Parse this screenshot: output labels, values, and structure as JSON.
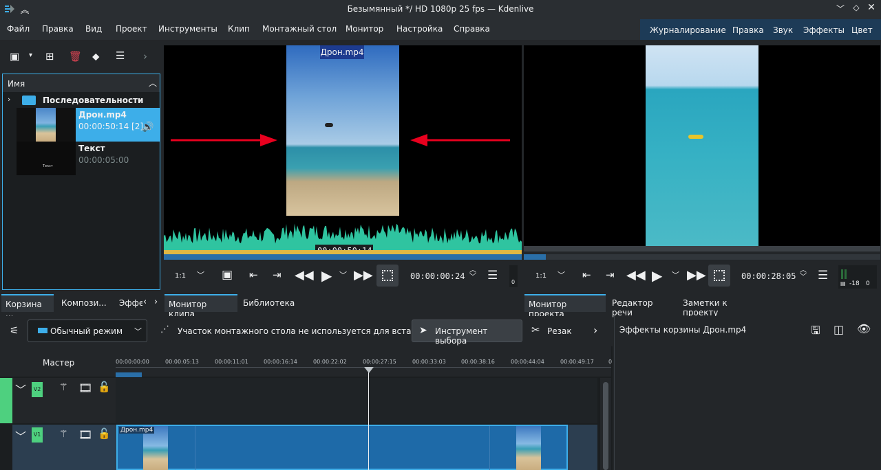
{
  "window": {
    "title": "Безымянный */ HD 1080p 25 fps — Kdenlive"
  },
  "menu": [
    "Файл",
    "Правка",
    "Вид",
    "Проект",
    "Инструменты",
    "Клип",
    "Монтажный стол",
    "Монитор",
    "Настройка",
    "Справка"
  ],
  "workspaces": [
    "Журналирование",
    "Правка",
    "Звук",
    "Эффекты",
    "Цвет"
  ],
  "bin": {
    "column_header": "Имя",
    "folder": "Последовательности",
    "clips": [
      {
        "name": "Дрон.mp4",
        "duration": "00:00:50:14 [2]"
      },
      {
        "name": "Текст",
        "duration": "00:00:05:00",
        "thumb_text": "Текст"
      }
    ]
  },
  "left_tabs": [
    "Корзина ...",
    "Компози...",
    "Эффе"
  ],
  "clip_monitor": {
    "clip_label": "Дрон.mp4",
    "overlay_timecode": "00:00:50:14",
    "zoom": "1:1",
    "timecode": "00:00:00:24",
    "audio_level": "0"
  },
  "clip_monitor_tabs": [
    "Монитор клипа",
    "Библиотека"
  ],
  "project_monitor": {
    "zoom": "1:1",
    "timecode": "00:00:28:05",
    "meter_db": "-18",
    "meter_val": "0"
  },
  "project_monitor_tabs": [
    "Монитор проекта",
    "Редактор речи",
    "Заметки к проекту"
  ],
  "timeline_toolbar": {
    "mode": "Обычный режим",
    "insert_info": "Участок монтажного стола не используется для вставки",
    "select_tool": "Инструмент выбора",
    "razor": "Резак"
  },
  "effects_panel": {
    "title": "Эффекты корзины Дрон.mp4"
  },
  "timeline": {
    "master": "Мастер",
    "ruler": [
      "00:00:00:00",
      "00:00:05:13",
      "00:00:11:01",
      "00:00:16:14",
      "00:00:22:02",
      "00:00:27:15",
      "00:00:33:03",
      "00:00:38:16",
      "00:00:44:04",
      "00:00:49:17",
      "0"
    ],
    "tracks": [
      {
        "name": "V2"
      },
      {
        "name": "V1"
      }
    ],
    "clip_label": "Дрон.mp4"
  },
  "colors": {
    "accent": "#3daee9",
    "waveform": "#2fc4a0",
    "track_green": "#4ed07f",
    "clip_blue": "#1e6aa8"
  }
}
